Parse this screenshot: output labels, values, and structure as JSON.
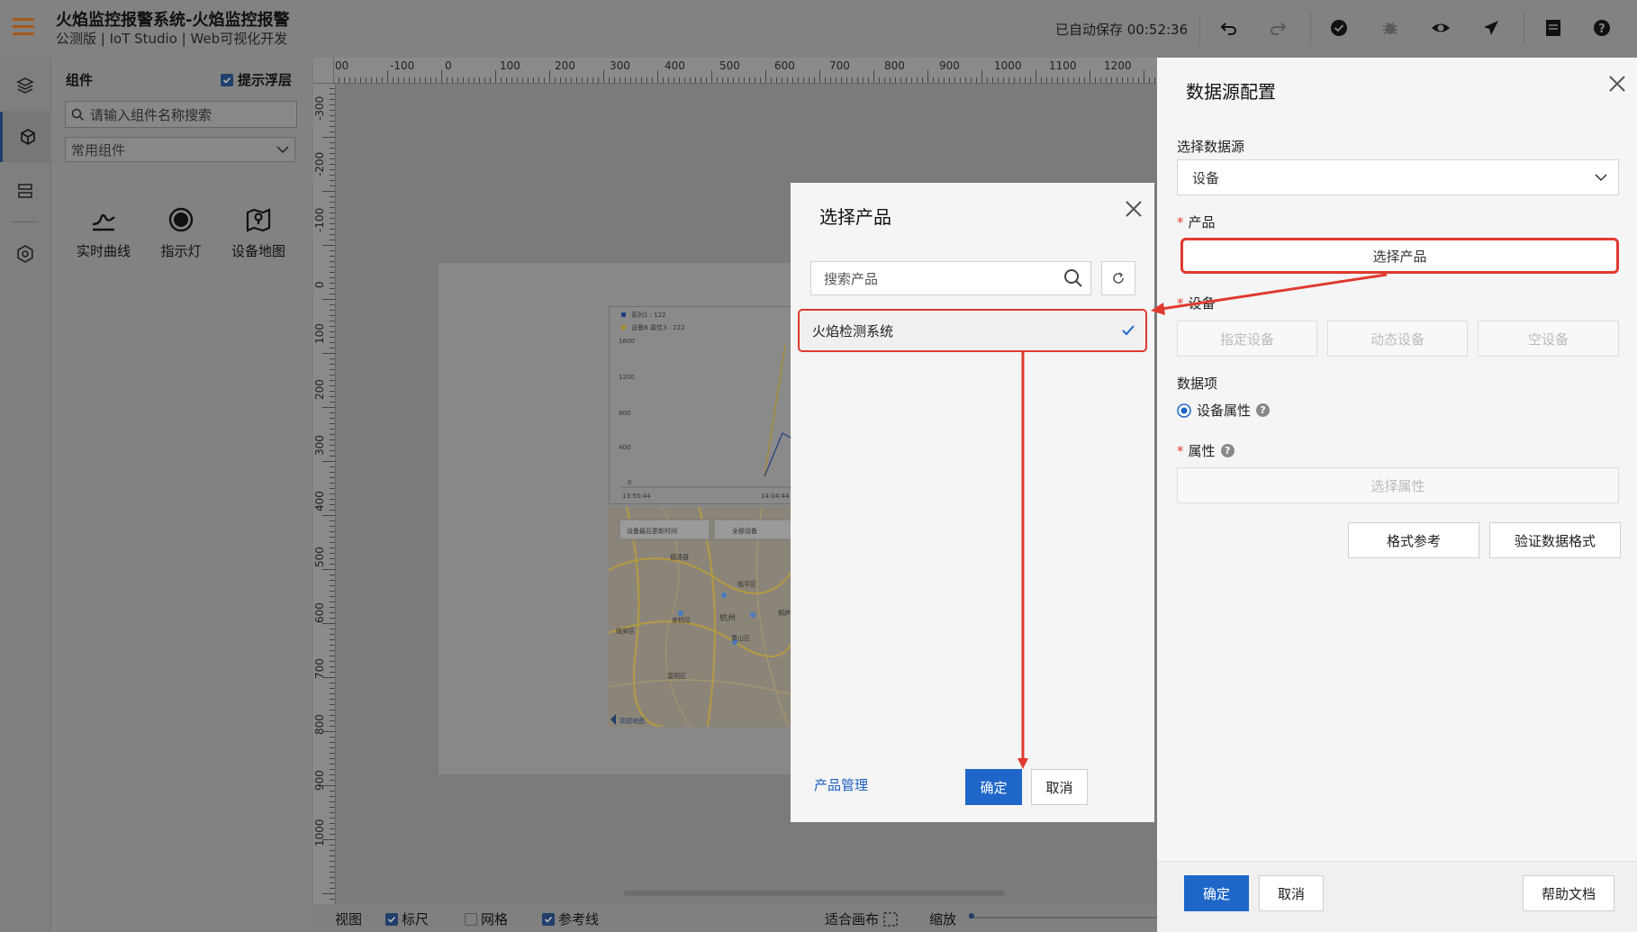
{
  "app": {
    "title": "火焰监控报警系统-火焰监控报警",
    "subtitle": "公测版 | IoT Studio | Web可视化开发",
    "autosave": "已自动保存 00:52:36"
  },
  "panel": {
    "header": "组件",
    "tip_label": "提示浮层",
    "search_placeholder": "请输入组件名称搜索",
    "category": "常用组件",
    "components": [
      {
        "label": "实时曲线",
        "icon": "realtime-curve-icon"
      },
      {
        "label": "指示灯",
        "icon": "indicator-light-icon"
      },
      {
        "label": "设备地图",
        "icon": "device-map-icon"
      }
    ]
  },
  "ruler": {
    "top": [
      "00",
      "-100",
      "0",
      "100",
      "200",
      "300",
      "400",
      "500",
      "600",
      "700",
      "800",
      "900",
      "1000",
      "1100",
      "1200"
    ],
    "left": [
      "-300",
      "-200",
      "-100",
      "0",
      "100",
      "200",
      "300",
      "400",
      "500",
      "600",
      "700",
      "800",
      "900",
      "1000"
    ]
  },
  "chart_preview": {
    "legend": [
      "系列1 : 122",
      "设备B 属性3 : 222"
    ],
    "yticks": [
      "1600",
      "1200",
      "800",
      "400",
      "0"
    ],
    "xticks": [
      "13:50:44",
      "14:04:44"
    ]
  },
  "map_preview": {
    "control1": "设备最后更新时间",
    "control2": "全部设备",
    "cities": [
      "杭州",
      "余杭区",
      "临平区",
      "萧山区",
      "富阳区",
      "临安区",
      "德清县",
      "桐庐县"
    ],
    "logo": "高德地图"
  },
  "bottombar": {
    "view": "视图",
    "ruler": "标尺",
    "grid": "网格",
    "guides": "参考线",
    "fit": "适合画布",
    "zoom": "缩放"
  },
  "modal": {
    "title": "选择产品",
    "search_placeholder": "搜索产品",
    "items": [
      {
        "name": "火焰检测系统",
        "selected": true
      }
    ],
    "manage_link": "产品管理",
    "ok": "确定",
    "cancel": "取消"
  },
  "drawer": {
    "title": "数据源配置",
    "datasource_label": "选择数据源",
    "datasource_value": "设备",
    "product_label": "产品",
    "product_button": "选择产品",
    "device_label": "设备",
    "device_options": [
      "指定设备",
      "动态设备",
      "空设备"
    ],
    "dataitem_label": "数据项",
    "dataitem_option": "设备属性",
    "property_label": "属性",
    "property_button": "选择属性",
    "format_ref": "格式参考",
    "validate": "验证数据格式",
    "ok": "确定",
    "cancel": "取消",
    "help": "帮助文档"
  },
  "colors": {
    "primary": "#1f66c9",
    "highlight": "#e03a2f",
    "accent_orange": "#a2591c"
  }
}
